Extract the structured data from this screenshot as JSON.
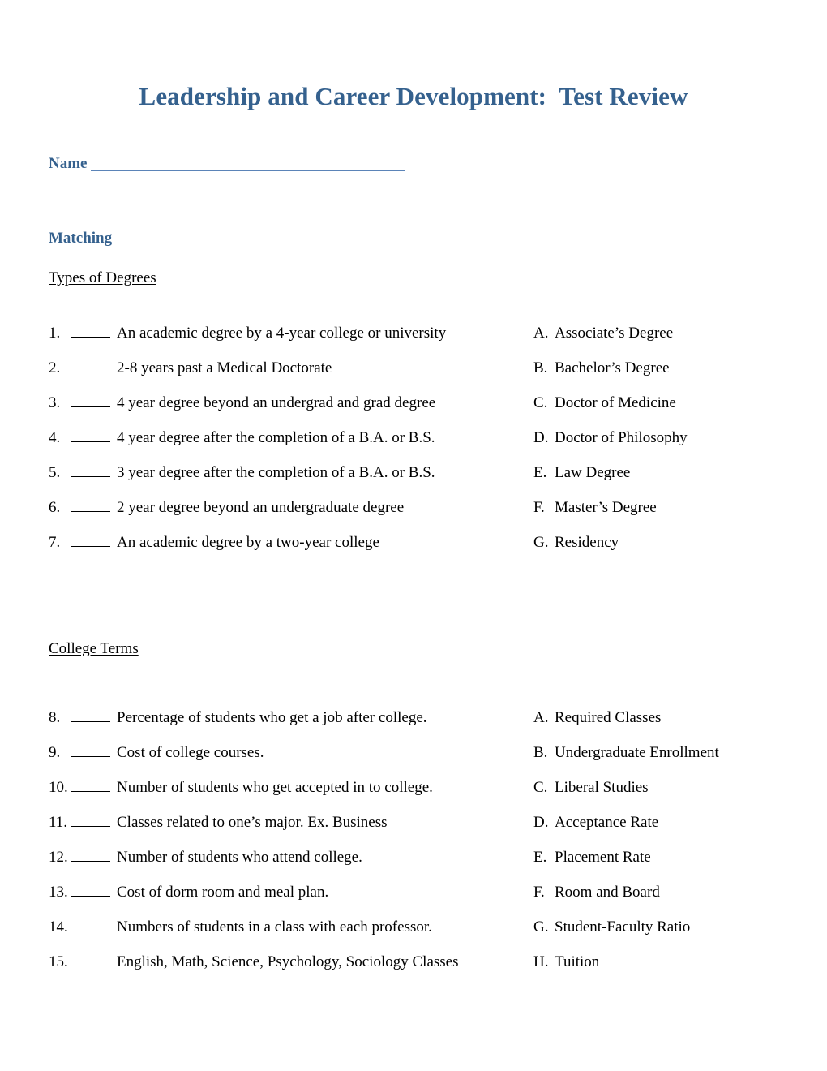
{
  "document": {
    "title": "Leadership and Career Development:  Test Review",
    "accent_color": "#35618e",
    "text_color": "#000000",
    "background_color": "#ffffff"
  },
  "name_field": {
    "label": "Name",
    "value": "",
    "placeholder": ""
  },
  "sections": [
    {
      "heading": "Matching",
      "subheading": "Types of Degrees",
      "questions": [
        {
          "number": "1.",
          "answer": "",
          "text": "An academic degree by a 4-year college or university"
        },
        {
          "number": "2.",
          "answer": "",
          "text": "2-8 years past a Medical Doctorate"
        },
        {
          "number": "3.",
          "answer": "",
          "text": "4 year degree beyond an undergrad and grad degree"
        },
        {
          "number": "4.",
          "answer": "",
          "text": "4 year degree after the completion of a B.A. or B.S."
        },
        {
          "number": "5.",
          "answer": "",
          "text": "3 year degree after the completion of a B.A. or B.S."
        },
        {
          "number": "6.",
          "answer": "",
          "text": "2 year degree beyond an undergraduate degree"
        },
        {
          "number": "7.",
          "answer": "",
          "text": "An academic degree by a two-year college"
        }
      ],
      "choices": [
        {
          "letter": "A.",
          "text": "Associate’s Degree"
        },
        {
          "letter": "B.",
          "text": "Bachelor’s Degree"
        },
        {
          "letter": "C.",
          "text": "Doctor of Medicine"
        },
        {
          "letter": "D.",
          "text": "Doctor of Philosophy"
        },
        {
          "letter": "E.",
          "text": "Law Degree"
        },
        {
          "letter": "F.",
          "text": "Master’s Degree"
        },
        {
          "letter": "G.",
          "text": "Residency"
        }
      ]
    },
    {
      "heading": "",
      "subheading": "College Terms",
      "questions": [
        {
          "number": "8.",
          "answer": "",
          "text": "Percentage of students who get a job after college."
        },
        {
          "number": "9.",
          "answer": "",
          "text": "Cost of college courses."
        },
        {
          "number": "10.",
          "answer": "",
          "text": "Number of students who get accepted in to college."
        },
        {
          "number": "11.",
          "answer": "",
          "text": "Classes related to one’s major. Ex. Business"
        },
        {
          "number": "12.",
          "answer": "",
          "text": "Number of students who attend college."
        },
        {
          "number": "13.",
          "answer": "",
          "text": "Cost of dorm room and meal plan."
        },
        {
          "number": "14.",
          "answer": "",
          "text": "Numbers of students in a class with each professor."
        },
        {
          "number": "15.",
          "answer": "",
          "text": "English, Math, Science, Psychology, Sociology Classes"
        }
      ],
      "choices": [
        {
          "letter": "A.",
          "text": "Required Classes"
        },
        {
          "letter": "B.",
          "text": "Undergraduate Enrollment"
        },
        {
          "letter": "C.",
          "text": "Liberal Studies"
        },
        {
          "letter": "D.",
          "text": "Acceptance Rate"
        },
        {
          "letter": "E.",
          "text": "Placement Rate"
        },
        {
          "letter": "F.",
          "text": "Room and Board"
        },
        {
          "letter": "G.",
          "text": "Student-Faculty Ratio"
        },
        {
          "letter": "H.",
          "text": "Tuition"
        }
      ]
    }
  ]
}
